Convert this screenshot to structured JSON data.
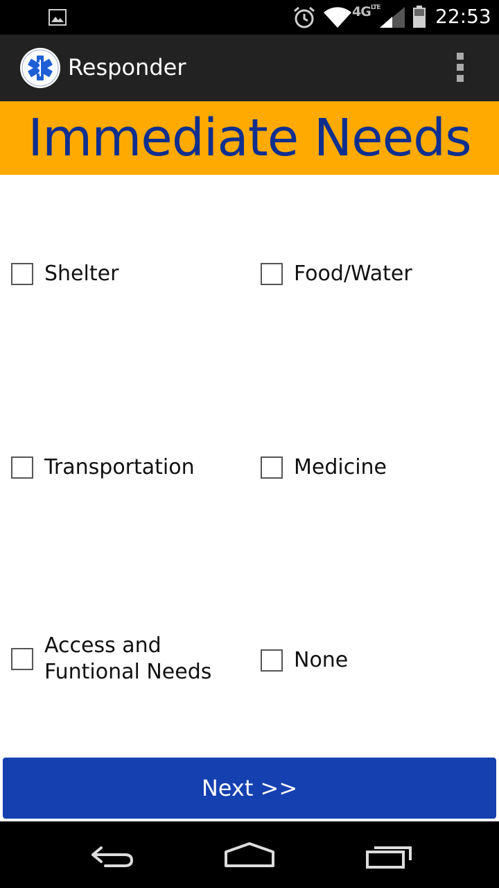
{
  "status_bar": {
    "network": "4G",
    "network_sub": "LTE",
    "time": "22:53",
    "icons": [
      "image-icon",
      "alarm-icon",
      "wifi-icon",
      "signal-icon",
      "battery-icon"
    ]
  },
  "action_bar": {
    "title": "Responder",
    "logo_icon": "star-of-life-logo",
    "menu_icon": "overflow-menu-icon"
  },
  "banner": {
    "title": "Immediate Needs"
  },
  "checkboxes": [
    {
      "label": "Shelter",
      "checked": false
    },
    {
      "label": "Food/Water",
      "checked": false
    },
    {
      "label": "Transportation",
      "checked": false
    },
    {
      "label": "Medicine",
      "checked": false
    },
    {
      "label": "Access and Funtional Needs",
      "checked": false
    },
    {
      "label": "None",
      "checked": false
    }
  ],
  "next_button": {
    "label": "Next >>"
  },
  "colors": {
    "banner_bg": "#ffaa00",
    "banner_text": "#0f2f8f",
    "button_bg": "#1440b0",
    "action_bar_bg": "#222222"
  },
  "nav_bar": {
    "icons": [
      "back-icon",
      "home-icon",
      "recent-apps-icon"
    ]
  }
}
